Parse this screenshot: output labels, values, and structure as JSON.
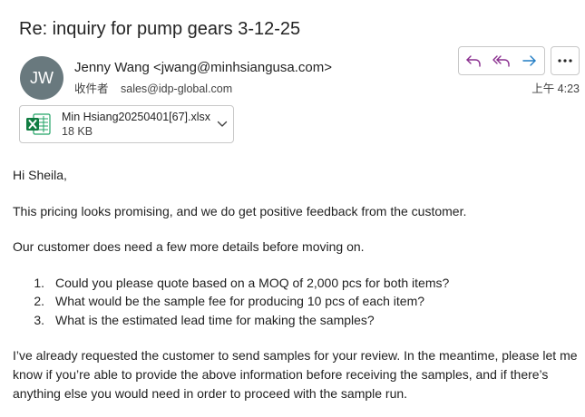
{
  "email": {
    "subject": "Re: inquiry for pump gears 3-12-25",
    "sender": {
      "initials": "JW",
      "display": "Jenny Wang <jwang@minhsiangusa.com>"
    },
    "recipient": {
      "label": "收件者",
      "address": "sales@idp-global.com"
    },
    "timestamp": "上午 4:23",
    "actions": {
      "reply": "reply-icon",
      "reply_all": "reply-all-icon",
      "forward": "forward-icon",
      "more": "more-icon"
    },
    "attachment": {
      "icon": "excel-icon",
      "name": "Min Hsiang20250401[67].xlsx",
      "size": "18 KB"
    },
    "body": {
      "greeting": "Hi Sheila,",
      "p1": "This pricing looks promising, and we do get positive feedback from the customer.",
      "p2": "Our customer does need a few more details before moving on.",
      "questions": [
        {
          "num": "1.",
          "text": "Could you please quote based on a MOQ of 2,000 pcs for both items?"
        },
        {
          "num": "2.",
          "text": "What would be the sample fee for producing 10 pcs of each item?"
        },
        {
          "num": "3.",
          "text": "What is the estimated lead time for making the samples?"
        }
      ],
      "closing": "I’ve already requested the customer to send samples for your review. In the meantime, please let me know if you’re able to provide the above information before receiving the samples, and if there’s anything else you would need in order to proceed with the sample run."
    }
  },
  "colors": {
    "avatar_bg": "#69797e",
    "action_accent": "#8a2f8f",
    "forward_accent": "#1f7bc4",
    "excel_green": "#107c41"
  }
}
